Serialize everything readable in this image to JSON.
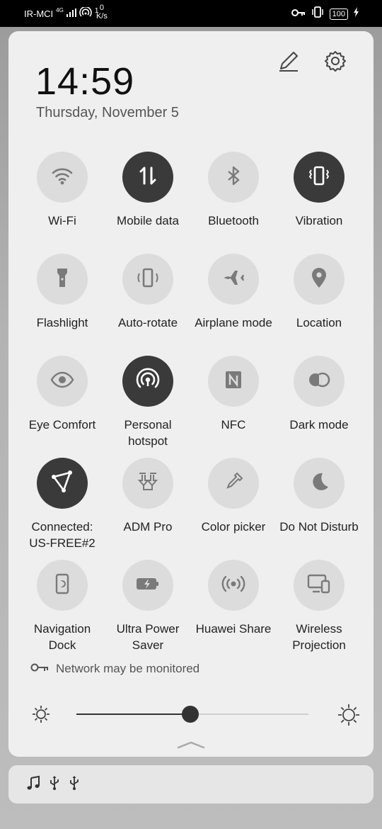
{
  "status_bar": {
    "carrier": "IR-MCI",
    "net_type": "4G",
    "hotspot_count": "1",
    "speed_value": "0",
    "speed_unit": "K/s",
    "battery": "100"
  },
  "header": {
    "time": "14:59",
    "date": "Thursday, November 5",
    "edit_icon": "pencil-icon",
    "settings_icon": "gear-icon"
  },
  "tiles": [
    {
      "label": "Wi-Fi",
      "active": false,
      "icon": "wifi-icon"
    },
    {
      "label": "Mobile data",
      "active": true,
      "icon": "mobile-data-icon"
    },
    {
      "label": "Bluetooth",
      "active": false,
      "icon": "bluetooth-icon"
    },
    {
      "label": "Vibration",
      "active": true,
      "icon": "vibration-icon"
    },
    {
      "label": "Flashlight",
      "active": false,
      "icon": "flashlight-icon"
    },
    {
      "label": "Auto-rotate",
      "active": false,
      "icon": "auto-rotate-icon"
    },
    {
      "label": "Airplane mode",
      "active": false,
      "icon": "airplane-icon"
    },
    {
      "label": "Location",
      "active": false,
      "icon": "location-icon"
    },
    {
      "label": "Eye Comfort",
      "active": false,
      "icon": "eye-icon"
    },
    {
      "label": "Personal hotspot",
      "active": true,
      "icon": "hotspot-icon"
    },
    {
      "label": "NFC",
      "active": false,
      "icon": "nfc-icon"
    },
    {
      "label": "Dark mode",
      "active": false,
      "icon": "dark-mode-icon"
    },
    {
      "label": "Connected: US-FREE#2",
      "active": true,
      "icon": "vpn-icon"
    },
    {
      "label": "ADM Pro",
      "active": false,
      "icon": "download-icon"
    },
    {
      "label": "Color picker",
      "active": false,
      "icon": "eyedropper-icon"
    },
    {
      "label": "Do Not Disturb",
      "active": false,
      "icon": "moon-icon"
    },
    {
      "label": "Navigation Dock",
      "active": false,
      "icon": "nav-dock-icon"
    },
    {
      "label": "Ultra Power Saver",
      "active": false,
      "icon": "battery-saver-icon"
    },
    {
      "label": "Huawei Share",
      "active": false,
      "icon": "share-signal-icon"
    },
    {
      "label": "Wireless Projection",
      "active": false,
      "icon": "projection-icon"
    }
  ],
  "network_notice": "Network may be monitored",
  "brightness": {
    "level": 0.49
  },
  "notification_icons": [
    "music-note-icon",
    "usb-icon",
    "usb-icon"
  ],
  "colors": {
    "active_tile": "#3a3a3a",
    "inactive_tile": "#dcdcdc",
    "panel": "#efefef"
  }
}
